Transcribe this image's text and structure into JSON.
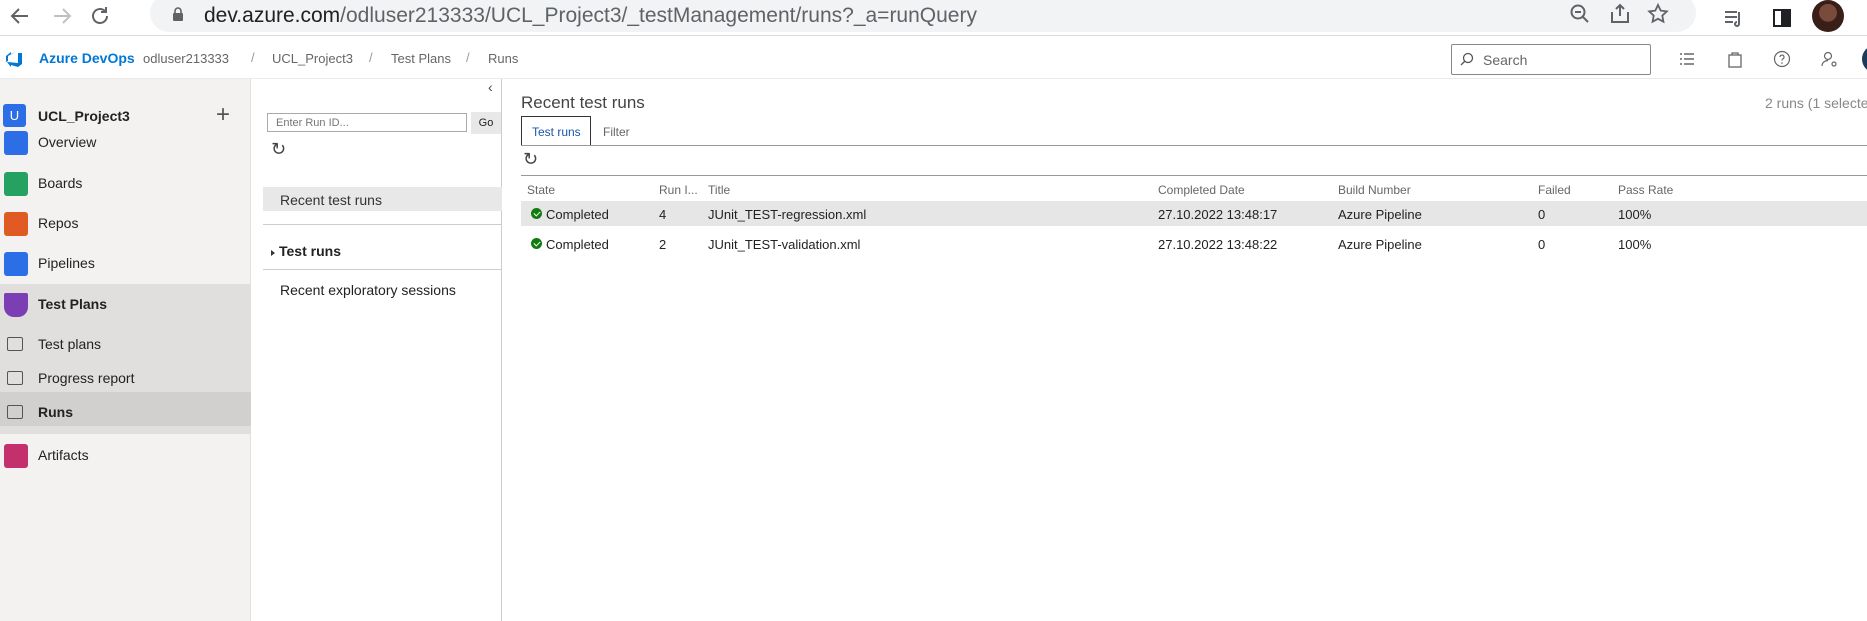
{
  "browser": {
    "url_host": "dev.azure.com",
    "url_path": "/odluser213333/UCL_Project3/_testManagement/runs?_a=runQuery"
  },
  "topbar": {
    "brand": "Azure DevOps",
    "breadcrumbs": [
      "odluser213333",
      "UCL_Project3",
      "Test Plans",
      "Runs"
    ],
    "separator": "/",
    "search_placeholder": "Search"
  },
  "sidebar": {
    "project_initial": "U",
    "project_name": "UCL_Project3",
    "items": [
      {
        "label": "Overview",
        "color": "#2b6ee6"
      },
      {
        "label": "Boards",
        "color": "#27a162"
      },
      {
        "label": "Repos",
        "color": "#e05a24"
      },
      {
        "label": "Pipelines",
        "color": "#2b6ee6"
      },
      {
        "label": "Test Plans",
        "color": "#7b3fb3"
      },
      {
        "label": "Test plans"
      },
      {
        "label": "Progress report"
      },
      {
        "label": "Runs"
      },
      {
        "label": "Artifacts",
        "color": "#c3306b"
      }
    ]
  },
  "midpanel": {
    "run_id_placeholder": "Enter Run ID...",
    "go_label": "Go",
    "recent_test_runs": "Recent test runs",
    "test_runs": "Test runs",
    "recent_exploratory": "Recent exploratory sessions"
  },
  "main": {
    "title": "Recent test runs",
    "count": "2 runs (1 selecte",
    "tab_test_runs": "Test runs",
    "tab_filter": "Filter",
    "columns": [
      "State",
      "Run I...",
      "Title",
      "Completed Date",
      "Build Number",
      "Failed",
      "Pass Rate"
    ],
    "rows": [
      {
        "state": "Completed",
        "run_id": "4",
        "title": "JUnit_TEST-regression.xml",
        "completed": "27.10.2022 13:48:17",
        "build": "Azure Pipeline",
        "failed": "0",
        "pass_rate": "100%"
      },
      {
        "state": "Completed",
        "run_id": "2",
        "title": "JUnit_TEST-validation.xml",
        "completed": "27.10.2022 13:48:22",
        "build": "Azure Pipeline",
        "failed": "0",
        "pass_rate": "100%"
      }
    ]
  }
}
